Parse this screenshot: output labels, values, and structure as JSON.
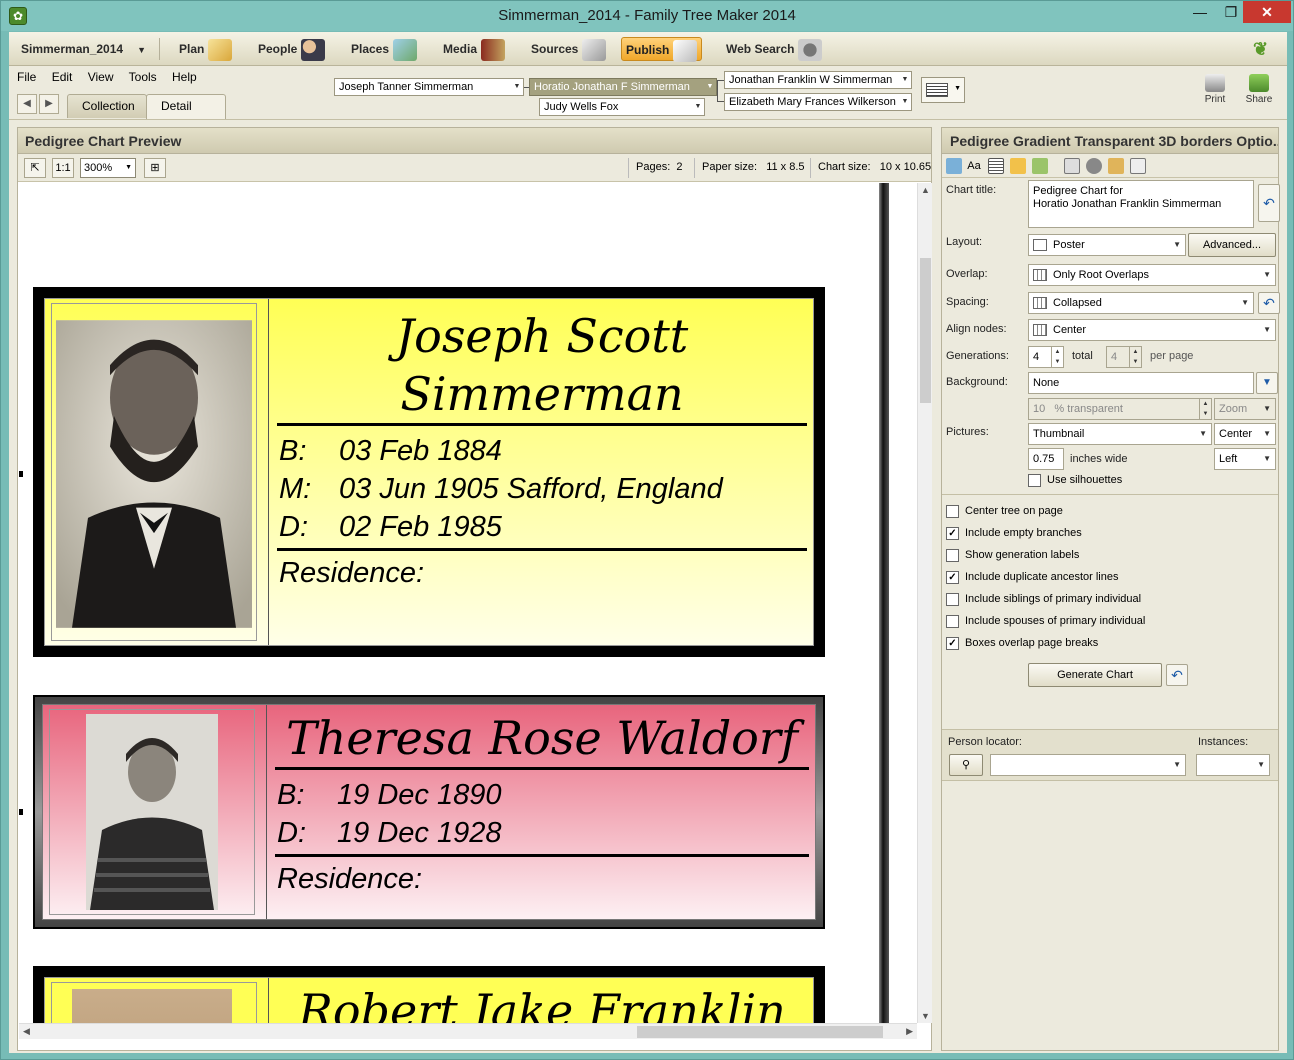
{
  "window": {
    "title": "Simmerman_2014 - Family Tree Maker 2014",
    "min": "—",
    "max": "❐",
    "close": "✕"
  },
  "toolbar": {
    "file_name": "Simmerman_2014",
    "plan": "Plan",
    "people": "People",
    "places": "Places",
    "media": "Media",
    "sources": "Sources",
    "publish": "Publish",
    "web_search": "Web Search"
  },
  "menu": {
    "file": "File",
    "edit": "Edit",
    "view": "View",
    "tools": "Tools",
    "help": "Help"
  },
  "view_tabs": {
    "collection": "Collection",
    "detail": "Detail"
  },
  "family_nav": {
    "father": "Joseph Tanner Simmerman",
    "selected": "Horatio Jonathan F Simmerman",
    "mother": "Judy Wells Fox",
    "child1": "Jonathan Franklin W Simmerman",
    "child2": "Elizabeth Mary Frances Wilkerson"
  },
  "right_tools": {
    "print": "Print",
    "share": "Share"
  },
  "preview": {
    "header": "Pedigree Chart Preview",
    "zoom": "300%",
    "pages_label": "Pages:",
    "pages": "2",
    "paper_label": "Paper size:",
    "paper": "11 x 8.5",
    "chart_label": "Chart size:",
    "chart": "10 x 10.65"
  },
  "persons": [
    {
      "name": "Joseph Scott Simmerman",
      "facts": [
        {
          "k": "B:",
          "v": "03 Feb 1884"
        },
        {
          "k": "M:",
          "v": "03 Jun 1905 Safford, England"
        },
        {
          "k": "D:",
          "v": "02 Feb 1985"
        }
      ],
      "residence": "Residence:"
    },
    {
      "name": "Theresa Rose Waldorf",
      "facts": [
        {
          "k": "B:",
          "v": "19 Dec 1890"
        },
        {
          "k": "D:",
          "v": "19 Dec 1928"
        }
      ],
      "residence": "Residence:"
    },
    {
      "name": "Robert Jake Franklin"
    }
  ],
  "options": {
    "header": "Pedigree Gradient Transparent 3D borders Optio...",
    "chart_title_label": "Chart title:",
    "chart_title_l1": "Pedigree Chart for",
    "chart_title_l2": "Horatio Jonathan Franklin Simmerman",
    "layout_label": "Layout:",
    "layout": "Poster",
    "advanced": "Advanced...",
    "overlap_label": "Overlap:",
    "overlap": "Only Root Overlaps",
    "spacing_label": "Spacing:",
    "spacing": "Collapsed",
    "align_label": "Align nodes:",
    "align": "Center",
    "generations_label": "Generations:",
    "generations": "4",
    "total_label": "total",
    "per_page_value": "4",
    "per_page_label": "per page",
    "background_label": "Background:",
    "background": "None",
    "transparent_value": "10",
    "transparent_label": "% transparent",
    "zoom": "Zoom",
    "pictures_label": "Pictures:",
    "pictures": "Thumbnail",
    "pic_align": "Center",
    "inches": "0.75",
    "inches_label": "inches wide",
    "pic_pos": "Left",
    "use_silhouettes": "Use silhouettes",
    "center_tree": "Center tree on page",
    "include_empty": "Include empty branches",
    "show_gen_labels": "Show generation labels",
    "include_dup": "Include duplicate ancestor lines",
    "include_siblings": "Include siblings of primary individual",
    "include_spouses": "Include spouses of primary individual",
    "boxes_overlap": "Boxes overlap page breaks",
    "generate": "Generate Chart",
    "person_locator": "Person locator:",
    "instances": "Instances:"
  },
  "colors": {
    "yellow_box": "#ffff55",
    "pink_box": "#e8657d",
    "accent_publish": "#f0a72a"
  }
}
